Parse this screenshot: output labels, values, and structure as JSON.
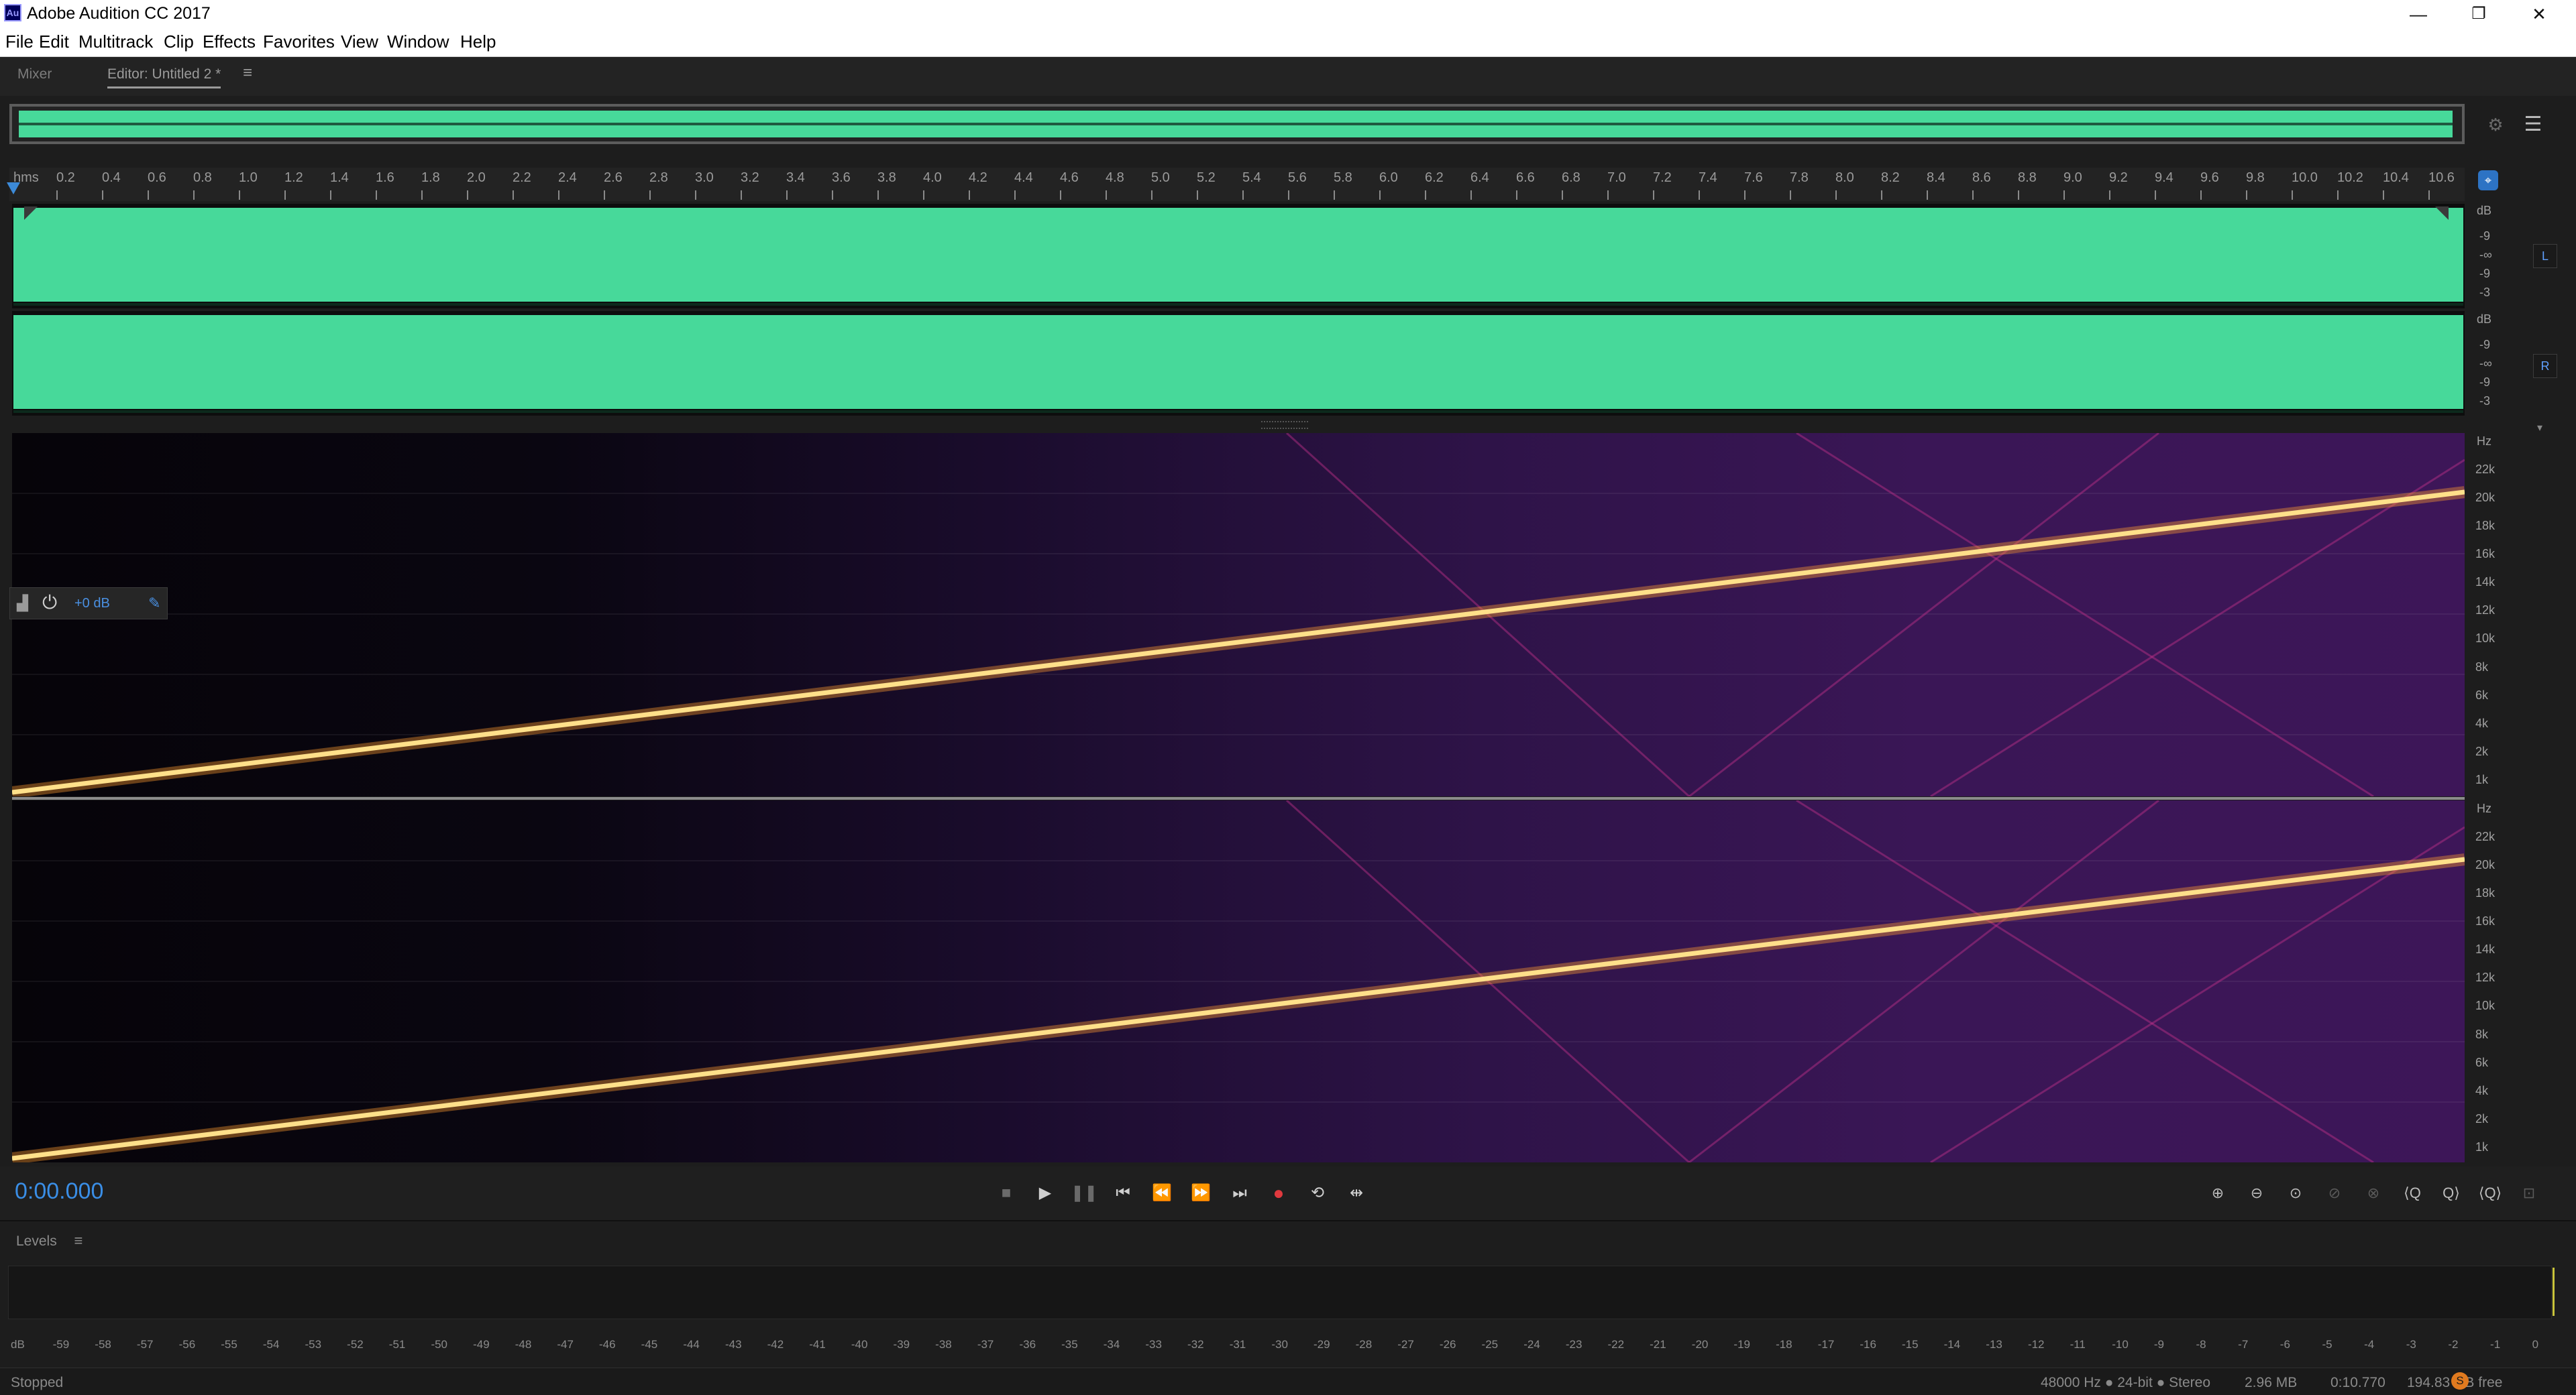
{
  "window": {
    "app_icon": "Au",
    "title": "Adobe Audition CC 2017",
    "minimize": "—",
    "maximize": "❐",
    "close": "✕"
  },
  "menu": [
    "File",
    "Edit",
    "Multitrack",
    "Clip",
    "Effects",
    "Favorites",
    "View",
    "Window",
    "Help"
  ],
  "panels": {
    "mixer_tab": "Mixer",
    "editor_tab": "Editor: Untitled 2 *",
    "menu_icon": "≡"
  },
  "ruler": {
    "unit": "hms",
    "labels": [
      "0.2",
      "0.4",
      "0.6",
      "0.8",
      "1.0",
      "1.2",
      "1.4",
      "1.6",
      "1.8",
      "2.0",
      "2.2",
      "2.4",
      "2.6",
      "2.8",
      "3.0",
      "3.2",
      "3.4",
      "3.6",
      "3.8",
      "4.0",
      "4.2",
      "4.4",
      "4.6",
      "4.8",
      "5.0",
      "5.2",
      "5.4",
      "5.6",
      "5.8",
      "6.0",
      "6.2",
      "6.4",
      "6.6",
      "6.8",
      "7.0",
      "7.2",
      "7.4",
      "7.6",
      "7.8",
      "8.0",
      "8.2",
      "8.4",
      "8.6",
      "8.8",
      "9.0",
      "9.2",
      "9.4",
      "9.6",
      "9.8",
      "10.0",
      "10.2",
      "10.4",
      "10.6"
    ]
  },
  "waveform": {
    "color": "#47d99a",
    "db_scale": [
      "dB",
      "-9",
      "-∞",
      "-9",
      "-3"
    ],
    "channel_left": "L",
    "channel_right": "R"
  },
  "spectral": {
    "hz_scale": [
      "Hz",
      "22k",
      "20k",
      "18k",
      "16k",
      "14k",
      "12k",
      "10k",
      "8k",
      "6k",
      "4k",
      "2k",
      "1k"
    ],
    "sweep_color": "#ffd27a"
  },
  "hud": {
    "volume": "+0 dB"
  },
  "transport": {
    "time": "0:00.000",
    "buttons": [
      "stop",
      "play",
      "pause",
      "go-to-start",
      "rewind",
      "fast-forward",
      "go-to-end",
      "record",
      "loop",
      "skip-selection"
    ]
  },
  "levels": {
    "tab": "Levels",
    "scale": [
      "dB",
      "-59",
      "-58",
      "-57",
      "-56",
      "-55",
      "-54",
      "-53",
      "-52",
      "-51",
      "-50",
      "-49",
      "-48",
      "-47",
      "-46",
      "-45",
      "-44",
      "-43",
      "-42",
      "-41",
      "-40",
      "-39",
      "-38",
      "-37",
      "-36",
      "-35",
      "-34",
      "-33",
      "-32",
      "-31",
      "-30",
      "-29",
      "-28",
      "-27",
      "-26",
      "-25",
      "-24",
      "-23",
      "-22",
      "-21",
      "-20",
      "-19",
      "-18",
      "-17",
      "-16",
      "-15",
      "-14",
      "-13",
      "-12",
      "-11",
      "-10",
      "-9",
      "-8",
      "-7",
      "-6",
      "-5",
      "-4",
      "-3",
      "-2",
      "-1",
      "0"
    ]
  },
  "status": {
    "state": "Stopped",
    "format": "48000 Hz ● 24-bit ● Stereo",
    "size": "2.96 MB",
    "duration": "0:10.770",
    "free": "194.83 GB free"
  }
}
